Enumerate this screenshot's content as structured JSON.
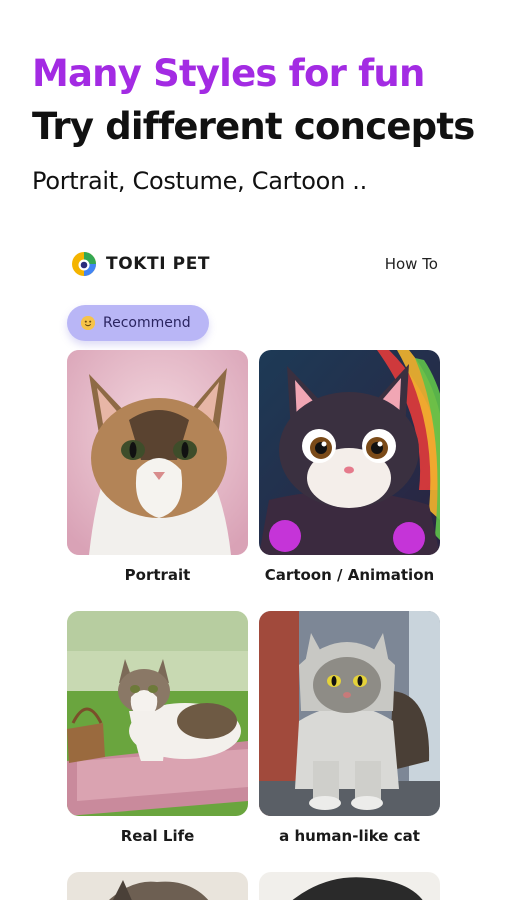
{
  "promo": {
    "headline_accent": "Many Styles for fun",
    "headline_main": "Try different concepts",
    "subline": "Portrait, Costume, Cartoon .."
  },
  "appbar": {
    "brand": "TOKTI PET",
    "howto": "How To"
  },
  "filter_chip": {
    "label": "Recommend"
  },
  "styles": [
    {
      "label": "Portrait"
    },
    {
      "label": "Cartoon / Animation"
    },
    {
      "label": "Real Life"
    },
    {
      "label": "a human-like cat"
    }
  ],
  "colors": {
    "accent": "#a32be3",
    "chip": "#b9b6f6"
  }
}
